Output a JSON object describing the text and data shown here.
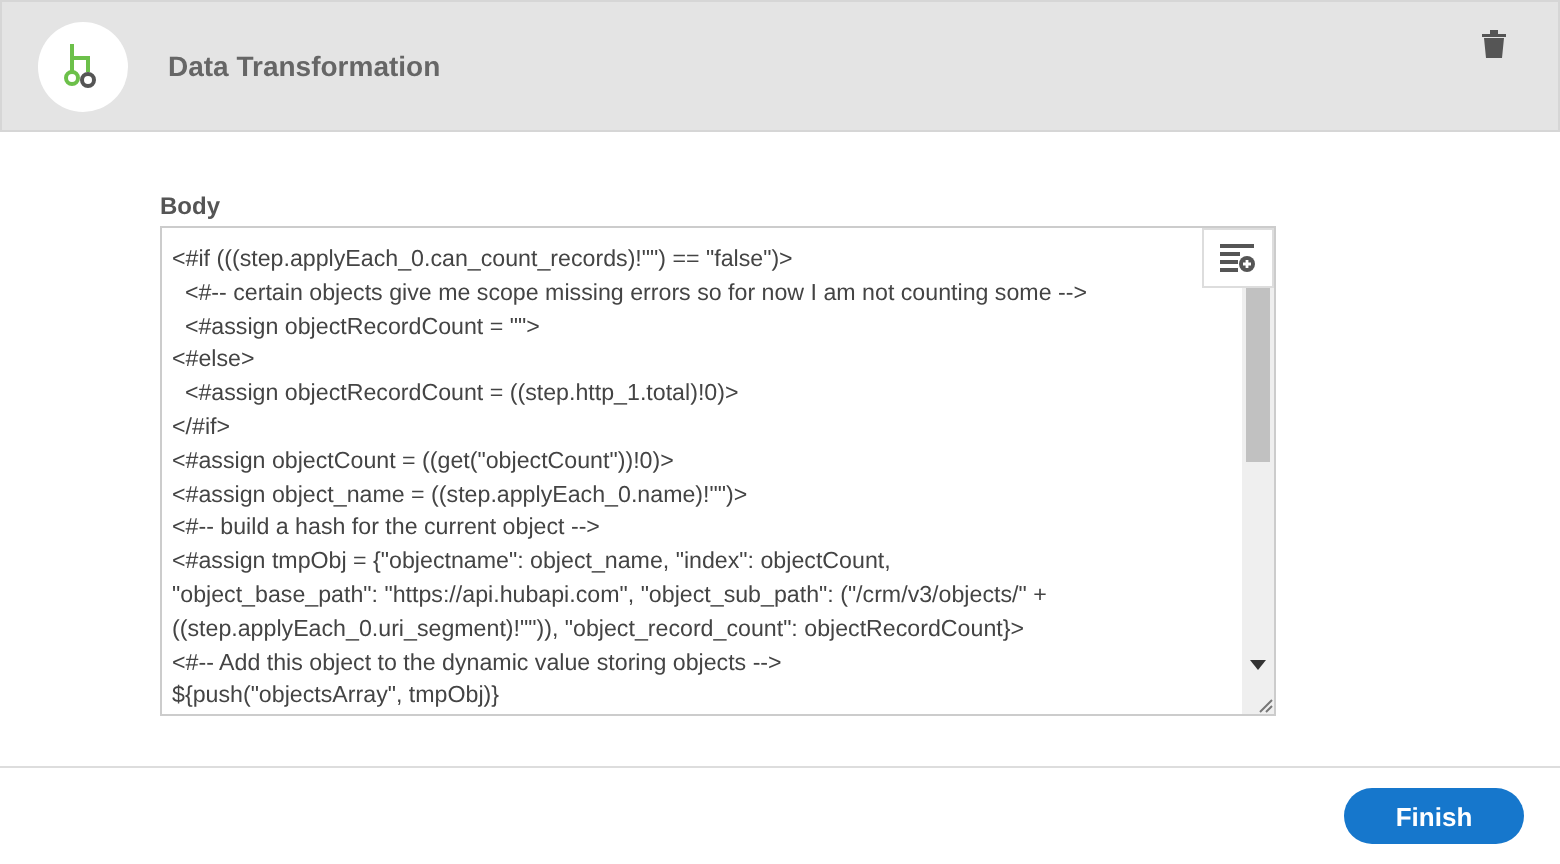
{
  "header": {
    "title": "Data Transformation"
  },
  "body": {
    "label": "Body",
    "lines": [
      "<#if (((step.applyEach_0.can_count_records)!\"\") == \"false\")>",
      "  <#-- certain objects give me scope missing errors so for now I am not counting some -->",
      "  <#assign objectRecordCount = \"\">",
      "<#else>",
      "  <#assign objectRecordCount = ((step.http_1.total)!0)>",
      "</#if>",
      "<#assign objectCount = ((get(\"objectCount\"))!0)>",
      "<#assign object_name = ((step.applyEach_0.name)!\"\")>",
      "<#-- build a hash for the current object -->",
      "<#assign tmpObj = {\"objectname\": object_name, \"index\": objectCount,",
      "\"object_base_path\": \"https://api.hubapi.com\", \"object_sub_path\": (\"/crm/v3/objects/\" +",
      "((step.applyEach_0.uri_segment)!\"\")), \"object_record_count\": objectRecordCount}>",
      "<#-- Add this object to the dynamic value storing objects -->",
      "${push(\"objectsArray\", tmpObj)}"
    ]
  },
  "buttons": [
    "Finish"
  ]
}
